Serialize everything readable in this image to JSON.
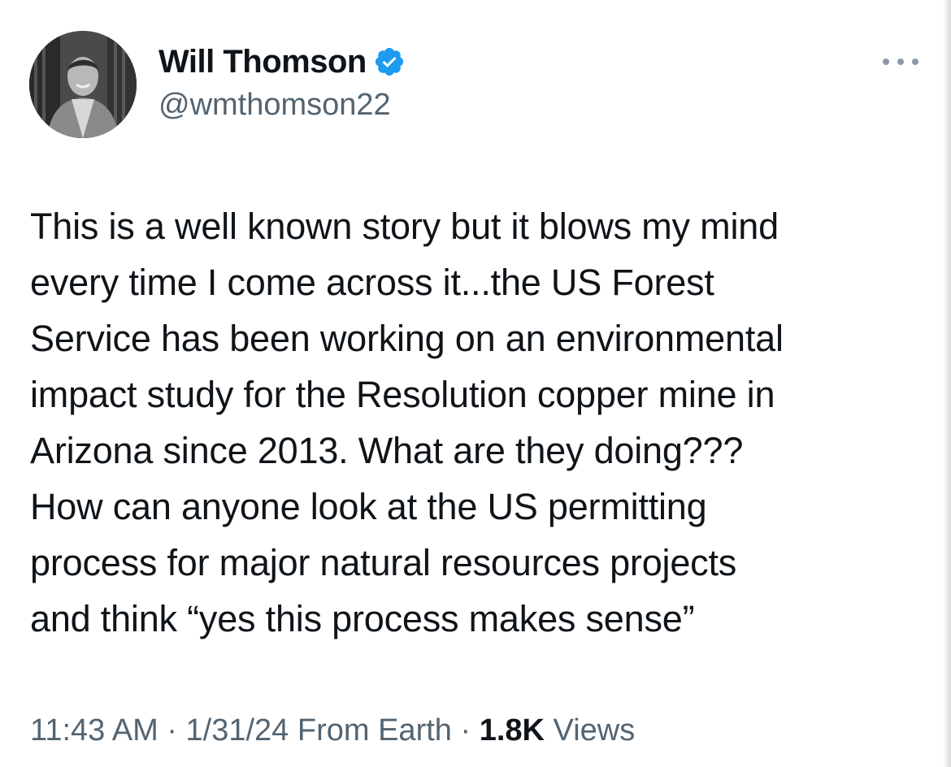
{
  "author": {
    "display_name": "Will Thomson",
    "handle": "@wmthomson22",
    "verified": true,
    "verified_color": "#1d9bf0"
  },
  "tweet": {
    "text": "This is a well known story but it blows my mind\nevery time I come across it...the US Forest\nService has been working on an environmental\nimpact study for the Resolution copper mine in\nArizona since 2013. What are they doing???\nHow can anyone look at the US permitting\nprocess for major natural resources projects\nand think “yes this process makes sense”"
  },
  "meta": {
    "time": "11:43 AM",
    "separator": "·",
    "date": "1/31/24",
    "source": "From Earth",
    "views_count": "1.8K",
    "views_label": "Views"
  },
  "icons": {
    "more": "more-horizontal-icon",
    "verified": "verified-badge-icon"
  },
  "colors": {
    "text_primary": "#0f1419",
    "text_secondary": "#536471"
  }
}
